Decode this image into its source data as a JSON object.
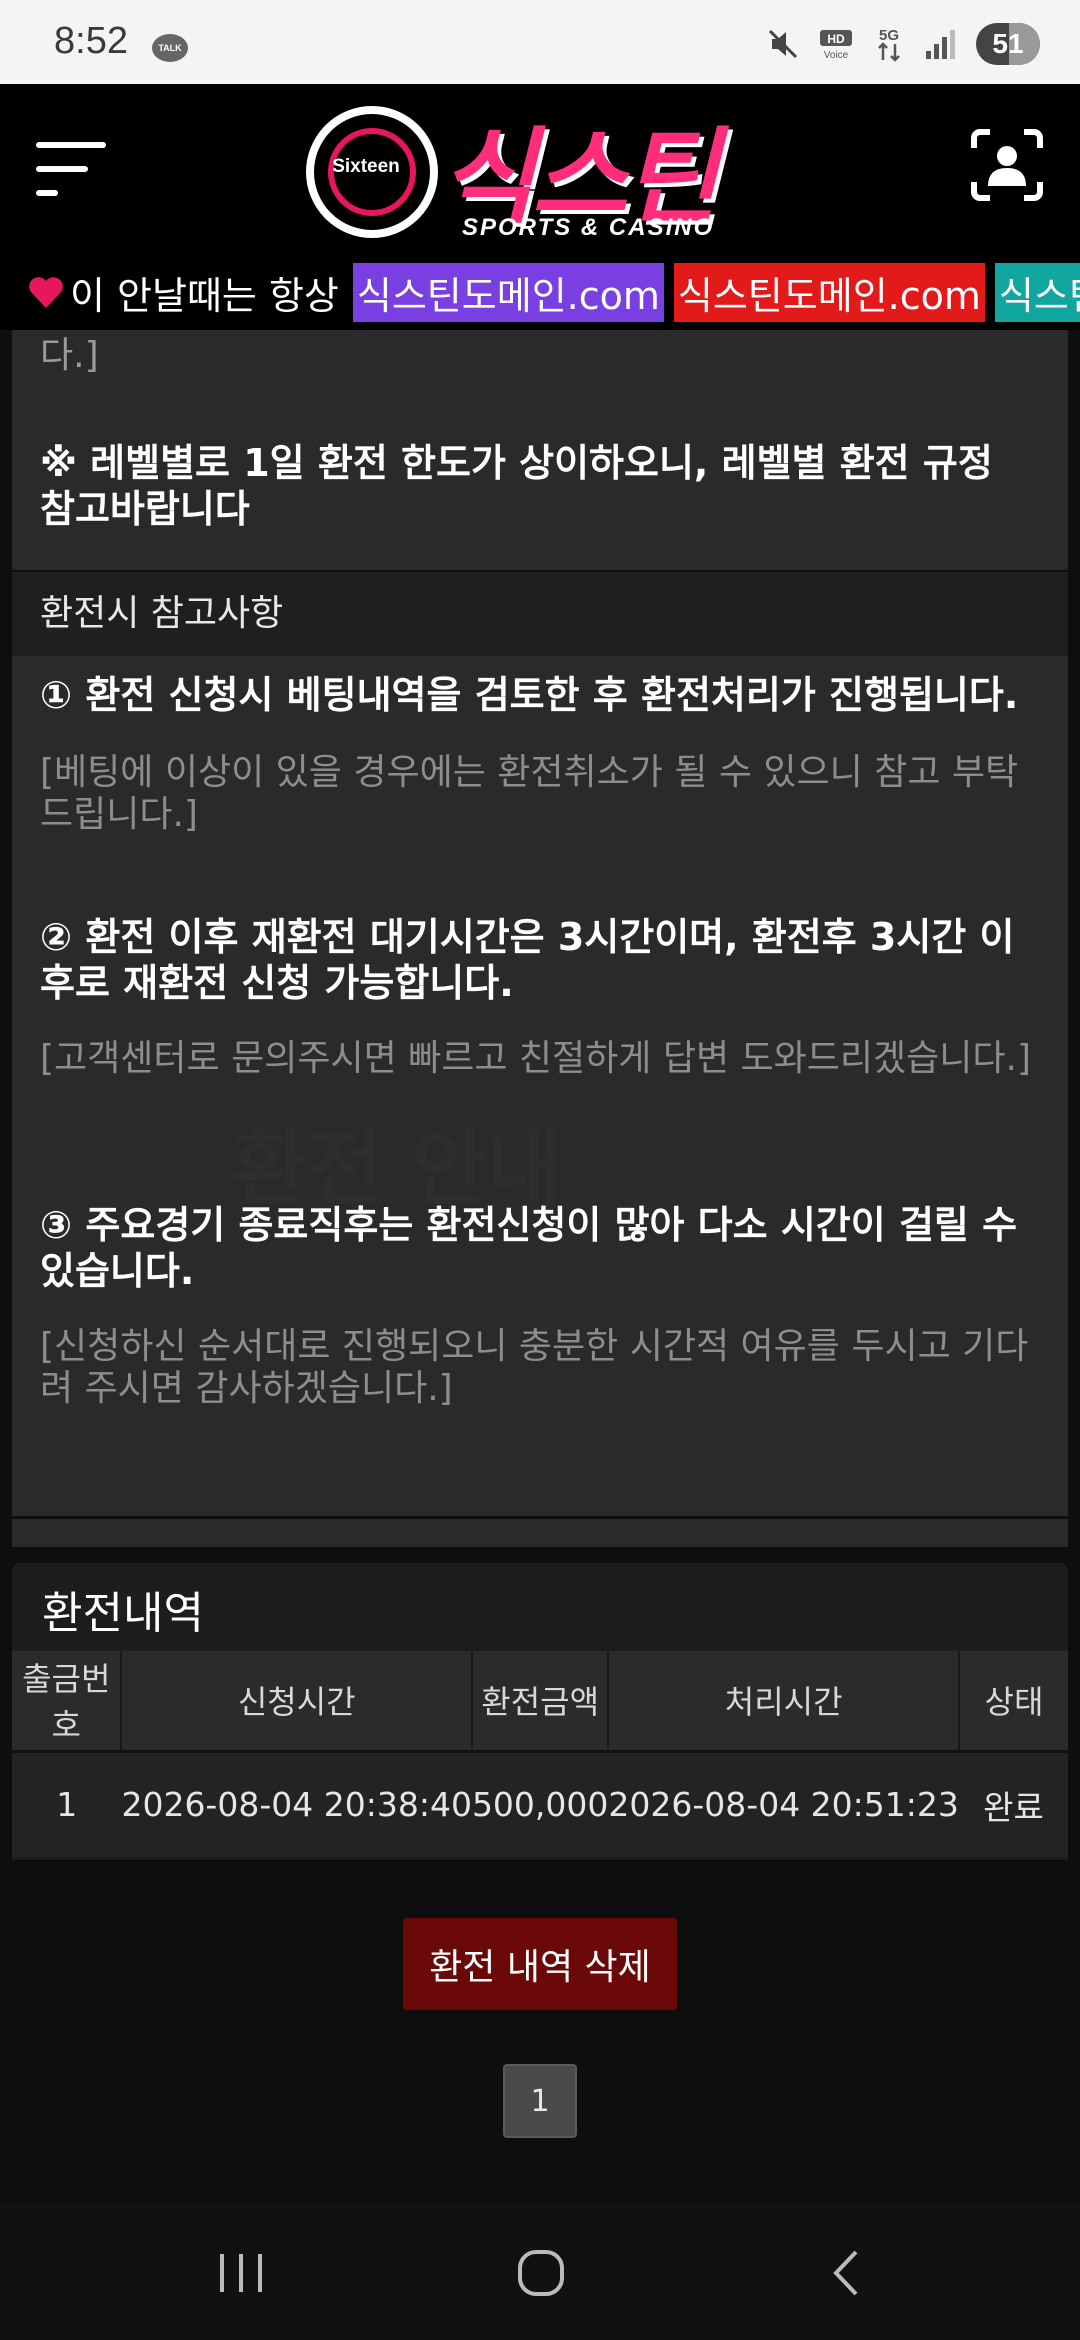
{
  "status_bar": {
    "time": "8:52",
    "talk_badge": "TALK",
    "battery_level_percent": 51,
    "battery_text": "51",
    "icons": [
      "talk-icon",
      "mute-icon",
      "hd-voice-icon",
      "5g-icon",
      "signal-icon",
      "battery-icon"
    ]
  },
  "header": {
    "logo_circle_text": "Sixteen",
    "logo_text": "식스틴",
    "logo_subtitle": "SPORTS & CASINO",
    "colors": {
      "brand_pink": "#ff2d7a",
      "background": "#000000"
    }
  },
  "ticker": {
    "text": "이 안날때는 항상",
    "chips": [
      {
        "text": "식스틴도메인.com",
        "color": "#7a3fe0"
      },
      {
        "text": "식스틴도메인.com",
        "color": "#e21a1a"
      },
      {
        "text": "식스틴",
        "color": "#12a6a0"
      }
    ]
  },
  "notice": {
    "fragment_top": "다.]",
    "level_note": "※ 레벨별로 1일 환전 한도가 상이하오니, 레벨별 환전 규정 참고바랍니다",
    "section_title": "환전시 참고사항",
    "items": [
      {
        "title": "① 환전 신청시 베팅내역을 검토한 후 환전처리가 진행됩니다.",
        "detail": "[베팅에 이상이 있을 경우에는 환전취소가 될 수 있으니 참고 부탁드립니다.]"
      },
      {
        "title": "② 환전 이후 재환전 대기시간은 3시간이며, 환전후 3시간 이후로 재환전 신청 가능합니다.",
        "detail": "[고객센터로 문의주시면 빠르고 친절하게 답변 도와드리겠습니다.]"
      },
      {
        "title": "③ 주요경기 종료직후는 환전신청이 많아 다소 시간이 걸릴 수 있습니다.",
        "detail": "[신청하신 순서대로 진행되오니 충분한 시간적 여유를 두시고 기다려 주시면 감사하겠습니다.]"
      }
    ]
  },
  "history": {
    "title": "환전내역",
    "columns": [
      "출금번호",
      "신청시간",
      "환전금액",
      "처리시간",
      "상태"
    ],
    "rows": [
      [
        "1",
        "2026-08-04 20:38:40",
        "500,000",
        "2026-08-04 20:51:23",
        "완료"
      ]
    ],
    "delete_label": "환전 내역 삭제",
    "current_page": "1"
  }
}
